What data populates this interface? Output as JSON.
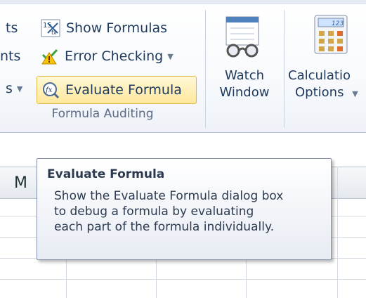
{
  "ribbon": {
    "row1": {
      "left_text": "ts",
      "label": "Show Formulas"
    },
    "row2": {
      "left_text": "nts",
      "label": "Error Checking"
    },
    "row3": {
      "left_text": "s",
      "label": "Evaluate Formula"
    },
    "group_label": "Formula Auditing",
    "watch_window": {
      "line1": "Watch",
      "line2": "Window"
    },
    "calculation": {
      "line1": "Calculatio",
      "line2": "Options"
    }
  },
  "grid": {
    "column_header": "M"
  },
  "tooltip": {
    "title": "Evaluate Formula",
    "body": "Show the Evaluate Formula dialog box to debug a formula by evaluating each part of the formula individually."
  },
  "colors": {
    "ribbon_text": "#1e395b",
    "highlight_fill": "#ffe79c",
    "highlight_border": "#e0b94a",
    "tooltip_border": "#8392a9"
  }
}
